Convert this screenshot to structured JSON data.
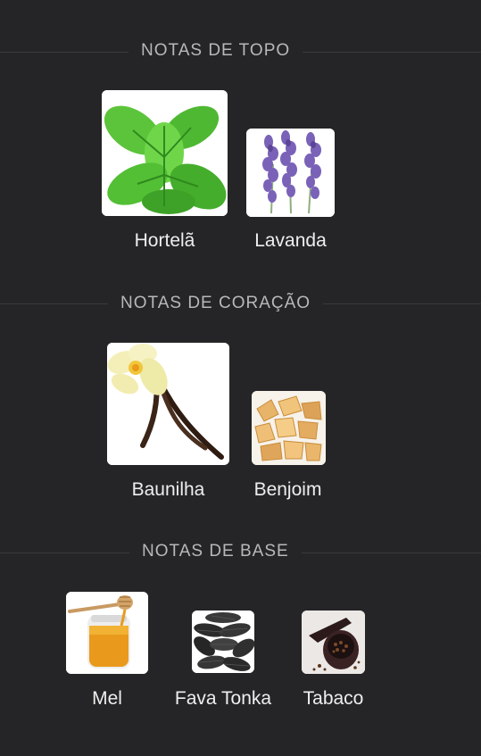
{
  "colors": {
    "background": "#252527",
    "heading": "#b8b8bb",
    "label": "#eeeeee",
    "divider": "#3a3a3c"
  },
  "sections": [
    {
      "heading": "NOTAS DE TOPO",
      "notes": [
        {
          "label": "Hortelã",
          "icon": "mint-leaves-image"
        },
        {
          "label": "Lavanda",
          "icon": "lavender-flowers-image"
        }
      ]
    },
    {
      "heading": "NOTAS DE CORAÇÃO",
      "notes": [
        {
          "label": "Baunilha",
          "icon": "vanilla-flower-pods-image"
        },
        {
          "label": "Benjoim",
          "icon": "benzoin-resin-image"
        }
      ]
    },
    {
      "heading": "NOTAS DE BASE",
      "notes": [
        {
          "label": "Mel",
          "icon": "honey-jar-image"
        },
        {
          "label": "Fava Tonka",
          "icon": "tonka-beans-image"
        },
        {
          "label": "Tabaco",
          "icon": "tobacco-pipe-image"
        }
      ]
    }
  ]
}
